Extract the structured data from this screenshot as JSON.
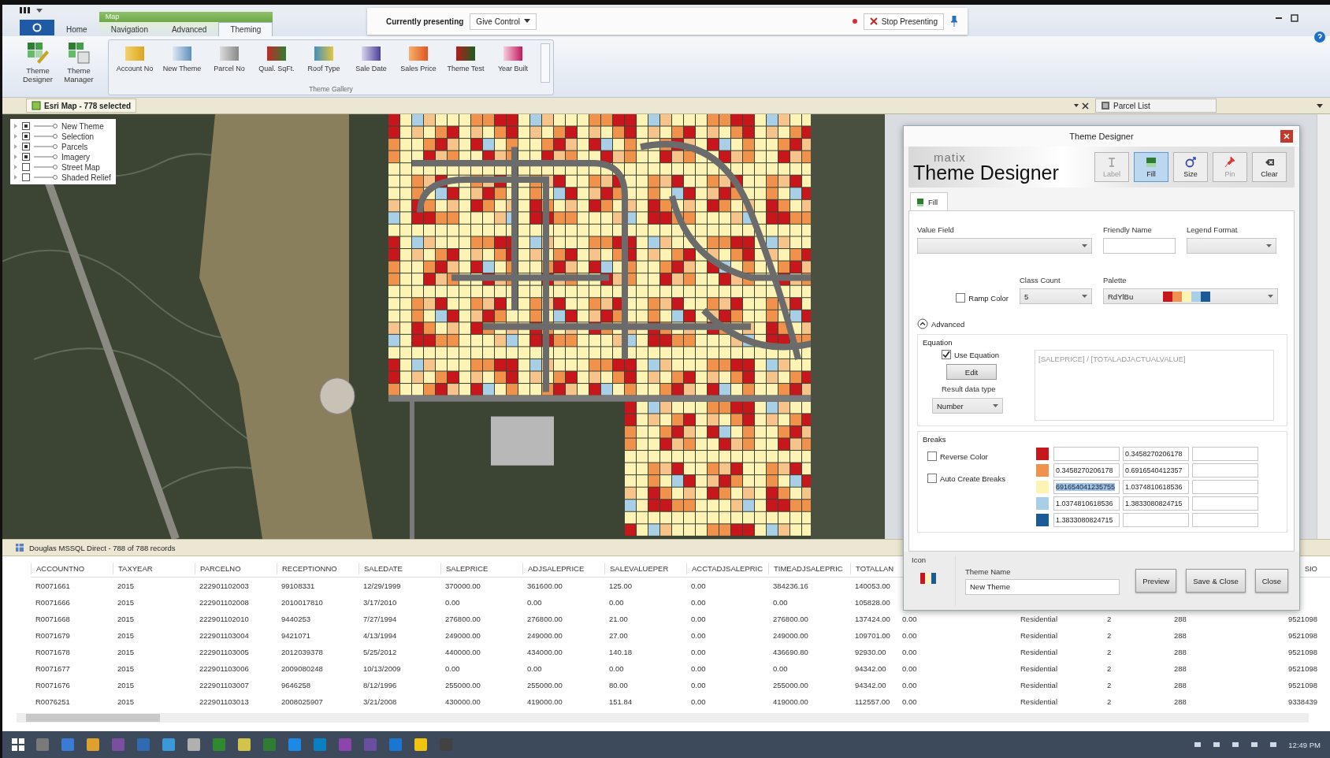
{
  "ribbon": {
    "context_group": "Map",
    "tabs": [
      {
        "label": "Home",
        "selected": false
      },
      {
        "label": "Navigation",
        "selected": false
      },
      {
        "label": "Advanced",
        "selected": false
      },
      {
        "label": "Theming",
        "selected": true
      }
    ],
    "buttons": [
      "Theme Designer",
      "Theme Manager"
    ],
    "gallery": {
      "items": [
        "Account No",
        "New Theme",
        "Parcel No",
        "Qual. SqFt.",
        "Roof Type",
        "Sale Date",
        "Sales Price",
        "Theme Test",
        "Year Built"
      ],
      "label": "Theme Gallery"
    }
  },
  "presenting_bar": {
    "status": "Currently presenting",
    "give_control": "Give Control",
    "stop": "Stop Presenting"
  },
  "map_panel": {
    "tab": "Esri Map - 778 selected",
    "side_tab": "Parcel List",
    "layers": [
      {
        "name": "New Theme",
        "checked": true
      },
      {
        "name": "Selection",
        "checked": true
      },
      {
        "name": "Parcels",
        "checked": true
      },
      {
        "name": "Imagery",
        "checked": true
      },
      {
        "name": "Street Map",
        "checked": false
      },
      {
        "name": "Shaded Relief",
        "checked": false
      }
    ]
  },
  "table_panel": {
    "title": "Douglas MSSQL Direct - 788 of 788 records",
    "columns": [
      "ACCOUNTNO",
      "TAXYEAR",
      "PARCELNO",
      "RECEPTIONNO",
      "SALEDATE",
      "SALEPRICE",
      "ADJSALEPRICE",
      "SALEVALUEPER",
      "ACCTADJSALEPRIC",
      "TIMEADJSALEPRIC",
      "TOTALLAN",
      null,
      null,
      null,
      null,
      "SIO"
    ],
    "rows": [
      [
        "R0071661",
        "2015",
        "222901102003",
        "99108331",
        "12/29/1999",
        "370000.00",
        "361600.00",
        "125.00",
        "0.00",
        "384236.16",
        "140053.00",
        null,
        null,
        null,
        null,
        null
      ],
      [
        "R0071666",
        "2015",
        "222901102008",
        "2010017810",
        "3/17/2010",
        "0.00",
        "0.00",
        "0.00",
        "0.00",
        "0.00",
        "105828.00",
        null,
        null,
        null,
        null,
        null
      ],
      [
        "R0071668",
        "2015",
        "222901102010",
        "9440253",
        "7/27/1994",
        "276800.00",
        "276800.00",
        "21.00",
        "0.00",
        "276800.00",
        "137424.00",
        "0.00",
        "Residential",
        "2",
        "288",
        "9521098"
      ],
      [
        "R0071679",
        "2015",
        "222901103004",
        "9421071",
        "4/13/1994",
        "249000.00",
        "249000.00",
        "27.00",
        "0.00",
        "249000.00",
        "109701.00",
        "0.00",
        "Residential",
        "2",
        "288",
        "9521098"
      ],
      [
        "R0071678",
        "2015",
        "222901103005",
        "2012039378",
        "5/25/2012",
        "440000.00",
        "434000.00",
        "140.18",
        "0.00",
        "436690.80",
        "92930.00",
        "0.00",
        "Residential",
        "2",
        "288",
        "9521098"
      ],
      [
        "R0071677",
        "2015",
        "222901103006",
        "2009080248",
        "10/13/2009",
        "0.00",
        "0.00",
        "0.00",
        "0.00",
        "0.00",
        "94342.00",
        "0.00",
        "Residential",
        "2",
        "288",
        "9521098"
      ],
      [
        "R0071676",
        "2015",
        "222901103007",
        "9646258",
        "8/12/1996",
        "255000.00",
        "255000.00",
        "80.00",
        "0.00",
        "255000.00",
        "94342.00",
        "0.00",
        "Residential",
        "2",
        "288",
        "9521098"
      ],
      [
        "R0076251",
        "2015",
        "222901103013",
        "2008025907",
        "3/21/2008",
        "430000.00",
        "419000.00",
        "151.84",
        "0.00",
        "419000.00",
        "112557.00",
        "0.00",
        "Residential",
        "2",
        "288",
        "9338439"
      ]
    ]
  },
  "theme_designer": {
    "title": "Theme Designer",
    "logo_small": "matix",
    "logo": "Theme Designer",
    "tools": [
      {
        "label": "Label",
        "selected": false,
        "disabled": true
      },
      {
        "label": "Fill",
        "selected": true,
        "disabled": false
      },
      {
        "label": "Size",
        "selected": false,
        "disabled": false
      },
      {
        "label": "Pin",
        "selected": false,
        "disabled": true
      },
      {
        "label": "Clear",
        "selected": false,
        "disabled": false
      }
    ],
    "tabs": [
      {
        "label": "Fill",
        "selected": true
      }
    ],
    "value_field": {
      "label": "Value Field"
    },
    "friendly_name": {
      "label": "Friendly Name"
    },
    "legend_format": {
      "label": "Legend Format"
    },
    "ramp_color": {
      "label": "Ramp Color",
      "checked": false
    },
    "class_count": {
      "label": "Class Count",
      "value": "5"
    },
    "palette": {
      "label": "Palette",
      "value": "RdYlBu",
      "swatches": [
        {
          "color": "#c8161d"
        },
        {
          "color": "#f0914c"
        },
        {
          "color": "#fdf3b4"
        },
        {
          "color": "#a8cfe6"
        },
        {
          "color": "#1a5a96"
        }
      ]
    },
    "advanced": {
      "label": "Advanced",
      "expanded": true
    },
    "equation": {
      "group": "Equation",
      "use": {
        "label": "Use Equation",
        "checked": true
      },
      "edit": "Edit",
      "result_label": "Result data type",
      "result_type": "Number",
      "text": "[SALEPRICE] / [TOTALADJACTUALVALUE]"
    },
    "breaks": {
      "group": "Breaks",
      "reverse": {
        "label": "Reverse Color",
        "checked": false
      },
      "auto": {
        "label": "Auto Create Breaks",
        "checked": false
      },
      "rows": [
        {
          "color": "#c8161d",
          "to": "0.3458270206178",
          "highlighted": false
        },
        {
          "color": "#f0914c",
          "from": "0.3458270206178",
          "to": "0.6916540412357",
          "highlighted": false
        },
        {
          "color": "#fdf3b4",
          "from": "691654041235755",
          "to": "1.0374810618536",
          "highlighted": true
        },
        {
          "color": "#a8cfe6",
          "from": "1.0374810618536",
          "to": "1.3833080824715",
          "highlighted": false
        },
        {
          "color": "#1a5a96",
          "from": "1.3833080824715",
          "highlighted": false
        }
      ]
    },
    "icon_label": "Icon",
    "name_label": "Theme Name",
    "name_value": "New Theme",
    "buttons": [
      "Preview",
      "Save & Close",
      "Close"
    ]
  },
  "taskbar": {
    "clock": "12:49 PM"
  }
}
